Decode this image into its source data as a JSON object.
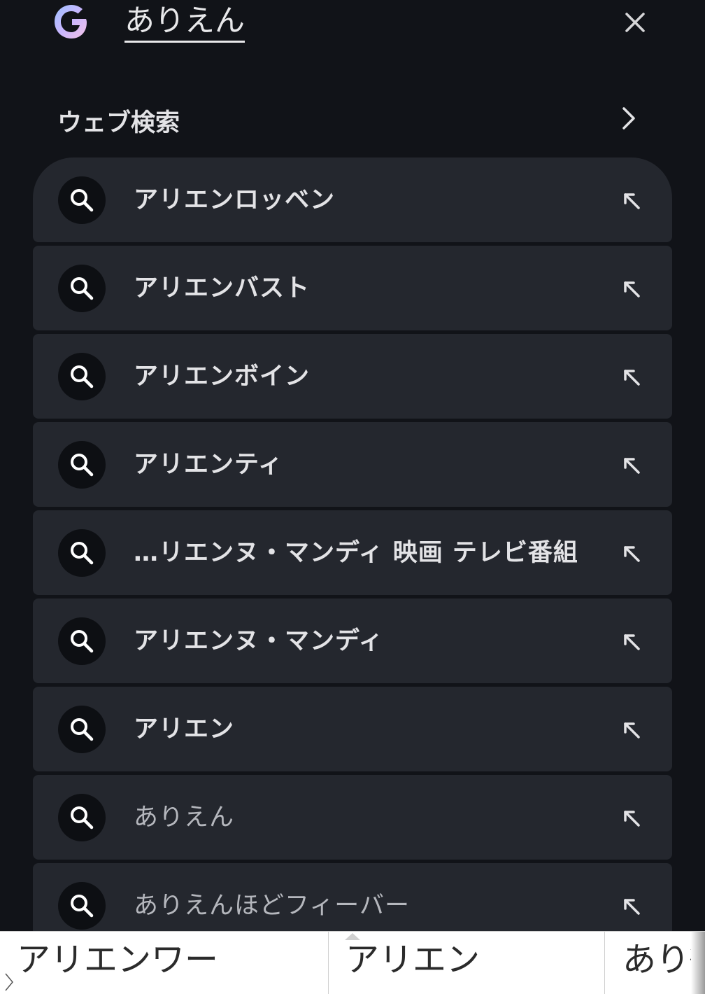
{
  "search": {
    "query": "ありえん",
    "logo_icon": "google-g-icon",
    "clear_icon": "close-icon"
  },
  "web_search": {
    "label": "ウェブ検索",
    "icon": "chevron-right-icon"
  },
  "suggestions": [
    {
      "text": "アリエンロッベン",
      "style": "bold"
    },
    {
      "text": "アリエンバスト",
      "style": "bold"
    },
    {
      "text": "アリエンボイン",
      "style": "bold"
    },
    {
      "text": "アリエンティ",
      "style": "bold"
    },
    {
      "text": "…リエンヌ・マンディ 映画 テレビ番組",
      "style": "bold"
    },
    {
      "text": "アリエンヌ・マンディ",
      "style": "bold"
    },
    {
      "text": "アリエン",
      "style": "bold"
    },
    {
      "text": "ありえん",
      "style": "dim"
    },
    {
      "text": "ありえんほどフィーバー",
      "style": "dim"
    }
  ],
  "keyboard_candidates": [
    "アリエンワー",
    "アリエン",
    "あり街"
  ],
  "colors": {
    "background": "#111318",
    "row": "#24272e",
    "icon_circle": "#0d0f13",
    "text": "#e3e3e6",
    "dim_text": "#b5b7bd"
  }
}
